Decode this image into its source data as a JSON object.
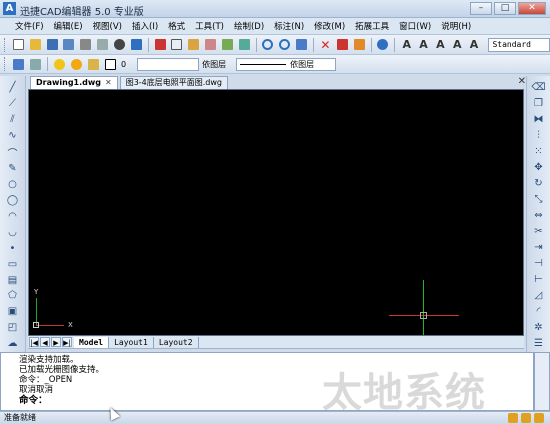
{
  "window": {
    "title": "迅捷CAD编辑器 5.0 专业版",
    "logo_letter": "A",
    "minimize": "–",
    "maximize": "□",
    "close": "✕"
  },
  "menu": [
    "文件(F)",
    "编辑(E)",
    "视图(V)",
    "插入(I)",
    "格式",
    "工具(T)",
    "绘制(D)",
    "标注(N)",
    "修改(M)",
    "拓展工具",
    "窗口(W)",
    "说明(H)"
  ],
  "toolbar": {
    "text_style": "Standard"
  },
  "layers": {
    "current_layer": "0",
    "linetype_label": "依图层",
    "lineweight_label": "依图层"
  },
  "doc_tabs": [
    {
      "label": "Drawing1.dwg",
      "close": "✕",
      "active": true
    },
    {
      "label": "图3-4底层电照平面图.dwg",
      "close": "",
      "active": false
    }
  ],
  "tabs_close_all": "✕",
  "canvas": {
    "ucs_y": "Y",
    "ucs_x": "X"
  },
  "layout_nav": [
    "|◀",
    "◀",
    "▶",
    "▶|"
  ],
  "layout_tabs": [
    "Model",
    "Layout1",
    "Layout2"
  ],
  "command_history": [
    "渲染支持加载。",
    "已加载光栅图像支持。",
    "命令：_OPEN",
    "取消取消"
  ],
  "command_prompt": "命令：",
  "status": {
    "text": "准备就绪"
  },
  "watermark": "太地系统"
}
